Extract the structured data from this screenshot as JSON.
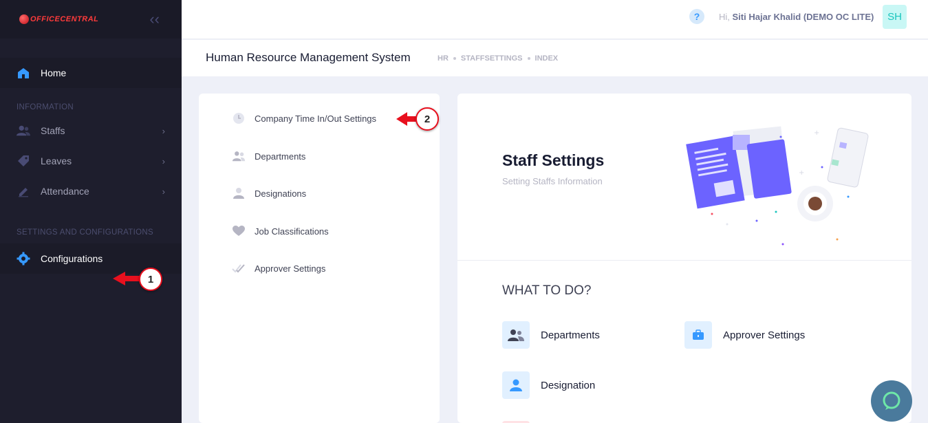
{
  "brand": {
    "logo_office": "OFFICE",
    "logo_central": "CENTRAL"
  },
  "sidebar": {
    "home_label": "Home",
    "section_information": "INFORMATION",
    "items": [
      {
        "label": "Staffs",
        "icon": "users-icon"
      },
      {
        "label": "Leaves",
        "icon": "tag-icon"
      },
      {
        "label": "Attendance",
        "icon": "pen-icon"
      }
    ],
    "section_settings": "SETTINGS AND CONFIGURATIONS",
    "configurations_label": "Configurations"
  },
  "topbar": {
    "help_symbol": "?",
    "greeting_prefix": "Hi,",
    "user_name": "Siti Hajar Khalid (DEMO OC LITE)",
    "avatar_initials": "SH"
  },
  "subheader": {
    "title": "Human Resource Management System",
    "breadcrumbs": [
      "HR",
      "STAFFSETTINGS",
      "INDEX"
    ]
  },
  "settings_nav": [
    {
      "label": "Company Time In/Out Settings",
      "icon": "clock-icon"
    },
    {
      "label": "Departments",
      "icon": "group-icon"
    },
    {
      "label": "Designations",
      "icon": "user-icon"
    },
    {
      "label": "Job Classifications",
      "icon": "heart-icon"
    },
    {
      "label": "Approver Settings",
      "icon": "double-check-icon"
    }
  ],
  "main": {
    "title": "Staff Settings",
    "subtitle": "Setting Staffs Information",
    "what_to_do": "WHAT TO DO?",
    "actions": [
      {
        "label": "Departments",
        "icon": "group-icon"
      },
      {
        "label": "Approver Settings",
        "icon": "briefcase-icon"
      },
      {
        "label": "Designation",
        "icon": "user-icon"
      }
    ]
  },
  "annotations": {
    "marker_1": "1",
    "marker_2": "2"
  },
  "colors": {
    "sidebar_bg": "#1e1e2d",
    "primary": "#3699ff",
    "marker_red": "#e8101e",
    "accent_purple": "#6c63ff"
  }
}
